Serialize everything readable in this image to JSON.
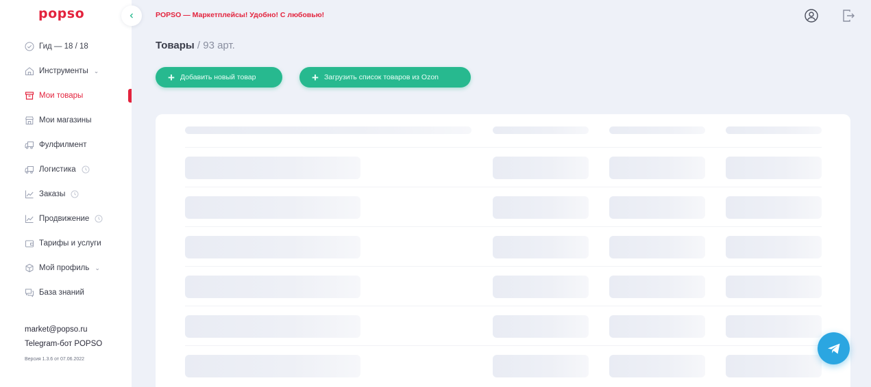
{
  "brand": {
    "logo_text": "popso",
    "accent_color": "#e3233d",
    "button_color": "#27b98f"
  },
  "header": {
    "tagline": "POPSO — Маркетплейсы! Удобно! С любовью!",
    "profile_icon": "user-circle-icon",
    "logout_icon": "logout-icon"
  },
  "sidebar": {
    "items": [
      {
        "label": "Гид — 18 / 18",
        "icon": "check-circle-icon"
      },
      {
        "label": "Инструменты",
        "icon": "home-icon",
        "has_submenu": true
      },
      {
        "label": "Мои товары",
        "icon": "box-icon",
        "active": true
      },
      {
        "label": "Мои магазины",
        "icon": "store-icon"
      },
      {
        "label": "Фулфилмент",
        "icon": "truck-icon"
      },
      {
        "label": "Логистика",
        "icon": "truck-icon",
        "clock": true
      },
      {
        "label": "Заказы",
        "icon": "chart-line-icon",
        "clock": true
      },
      {
        "label": "Продвижение",
        "icon": "chart-line-icon",
        "clock": true
      },
      {
        "label": "Тарифы и услуги",
        "icon": "wallet-icon"
      },
      {
        "label": "Мой профиль",
        "icon": "cube-icon",
        "has_submenu": true
      },
      {
        "label": "База знаний",
        "icon": "chat-icon"
      }
    ],
    "contacts": {
      "email": "market@popso.ru",
      "telegram": "Telegram-бот POPSO",
      "version": "Версия 1.3.6 от 07.06.2022"
    }
  },
  "main": {
    "title": "Товары",
    "count": "/ 93 арт.",
    "buttons": {
      "add_label": "Добавить новый товар",
      "upload_label": "Загрузить список товаров из Ozon"
    }
  }
}
